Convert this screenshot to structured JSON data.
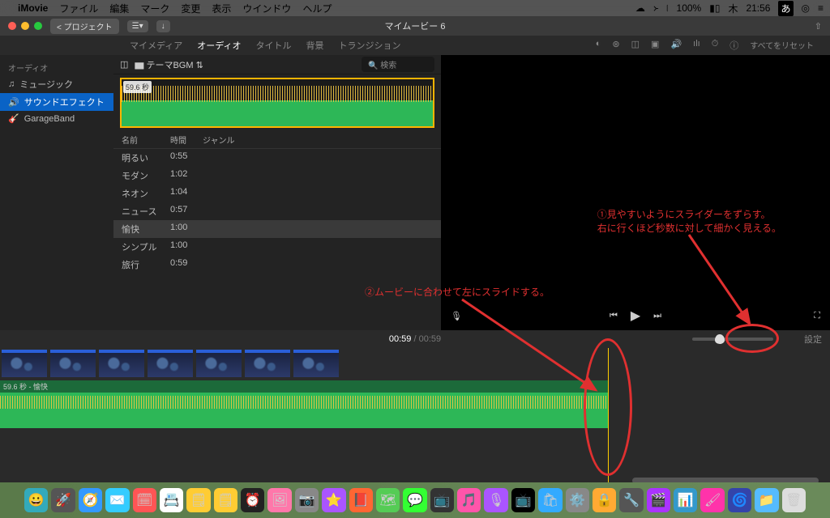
{
  "menubar": {
    "app": "iMovie",
    "items": [
      "ファイル",
      "編集",
      "マーク",
      "変更",
      "表示",
      "ウインドウ",
      "ヘルプ"
    ],
    "battery": "100%",
    "day": "木",
    "time": "21:56",
    "ime": "あ"
  },
  "titlebar": {
    "back": "プロジェクト",
    "title": "マイムービー 6"
  },
  "tabs": {
    "items": [
      "マイメディア",
      "オーディオ",
      "タイトル",
      "背景",
      "トランジション"
    ],
    "active": 1,
    "reset": "すべてをリセット"
  },
  "sidebar": {
    "header": "オーディオ",
    "items": [
      {
        "label": "ミュージック",
        "icon": "♫"
      },
      {
        "label": "サウンドエフェクト",
        "icon": "🔊",
        "selected": true
      },
      {
        "label": "GarageBand",
        "icon": "🎸"
      }
    ]
  },
  "browser": {
    "folder": "テーマBGM",
    "search_ph": "検索",
    "clip_duration": "59.6 秒",
    "columns": [
      "名前",
      "時間",
      "ジャンル"
    ],
    "rows": [
      {
        "name": "明るい",
        "time": "0:55"
      },
      {
        "name": "モダン",
        "time": "1:02"
      },
      {
        "name": "ネオン",
        "time": "1:04"
      },
      {
        "name": "ニュース",
        "time": "0:57"
      },
      {
        "name": "愉快",
        "time": "1:00",
        "selected": true
      },
      {
        "name": "シンプル",
        "time": "1:00"
      },
      {
        "name": "旅行",
        "time": "0:59"
      }
    ]
  },
  "timehead": {
    "current": "00:59",
    "duration": "00:59",
    "settings": "設定"
  },
  "timeline": {
    "audio_label": "59.6 秒 - 愉快"
  },
  "annotations": {
    "a1_l1": "①見やすいようにスライダーをずらす。",
    "a1_l2": "右に行くほど秒数に対して細かく見える。",
    "a2": "②ムービーに合わせて左にスライドする。"
  },
  "dock_icons": [
    "😀",
    "🚀",
    "🧭",
    "✉️",
    "🗓",
    "📇",
    "🗒",
    "🗒",
    "⏰",
    "🖼",
    "📷",
    "⭐",
    "📕",
    "🗺",
    "💬",
    "📺",
    "🎵",
    "🎙",
    "📺",
    "🛍",
    "⚙️",
    "🔒",
    "🔧",
    "🎬",
    "📊",
    "🖌",
    "🌀",
    "📁",
    "🗑"
  ]
}
